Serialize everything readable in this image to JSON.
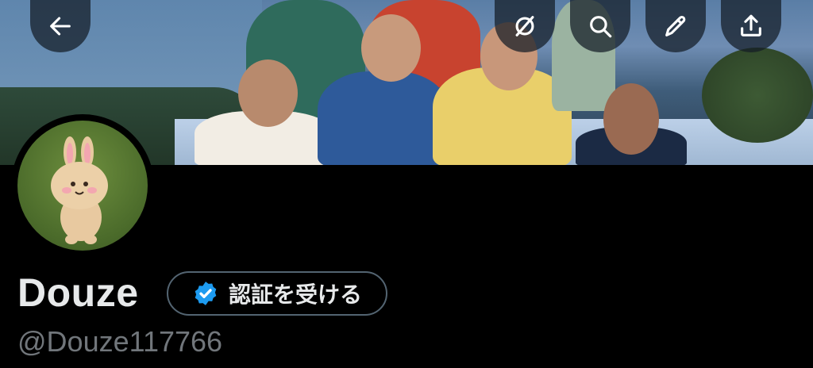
{
  "profile": {
    "name": "Douze",
    "handle": "@Douze117766",
    "verify_label": "認証を受ける"
  },
  "header": {
    "buttons": [
      {
        "name": "back",
        "icon": "arrow-left-icon"
      },
      {
        "name": "grok",
        "icon": "circle-slash-icon"
      },
      {
        "name": "search",
        "icon": "search-icon"
      },
      {
        "name": "edit",
        "icon": "pencil-icon"
      },
      {
        "name": "share",
        "icon": "upload-icon"
      }
    ]
  },
  "colors": {
    "background": "#000000",
    "text": "#e7e9ea",
    "secondary_text": "#71767b",
    "verified_blue": "#1d9bf0",
    "button_border": "#536471"
  }
}
